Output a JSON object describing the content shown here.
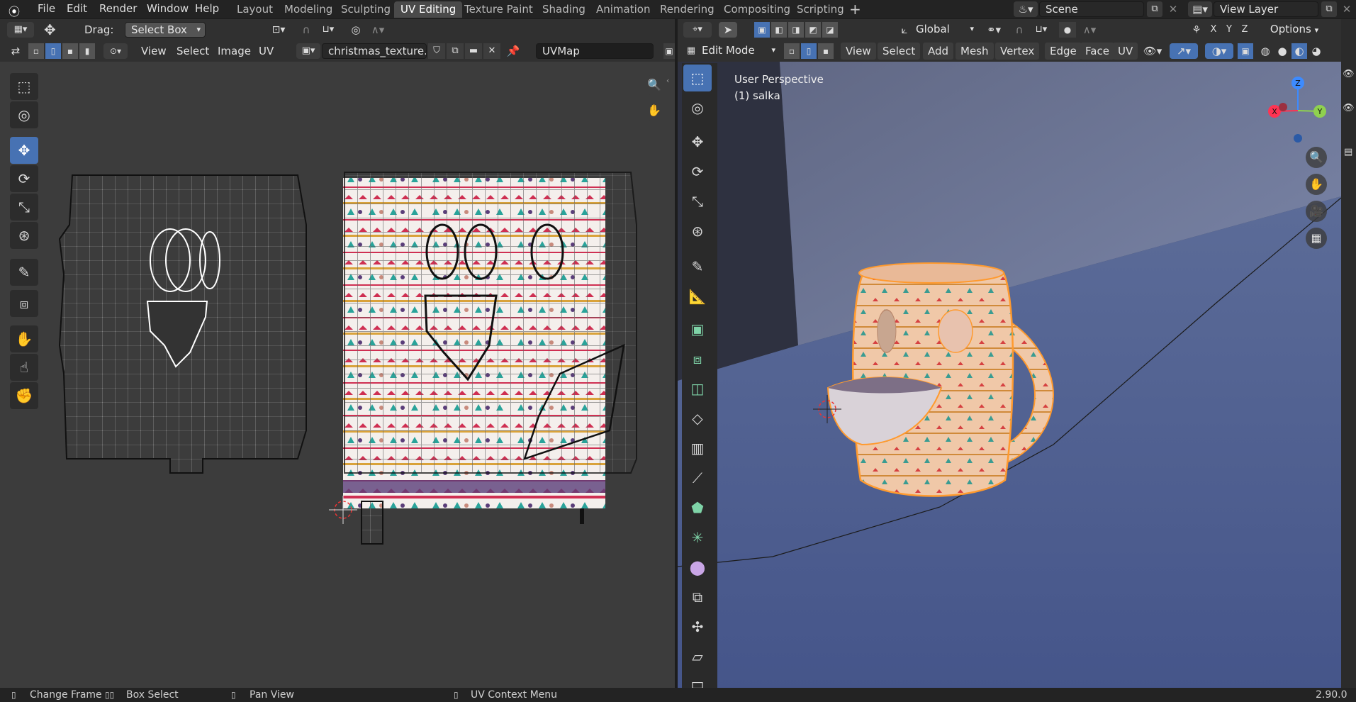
{
  "menus": [
    "File",
    "Edit",
    "Render",
    "Window",
    "Help"
  ],
  "workspace_tabs": [
    {
      "label": "Layout",
      "active": false
    },
    {
      "label": "Modeling",
      "active": false
    },
    {
      "label": "Sculpting",
      "active": false
    },
    {
      "label": "UV Editing",
      "active": true
    },
    {
      "label": "Texture Paint",
      "active": false
    },
    {
      "label": "Shading",
      "active": false
    },
    {
      "label": "Animation",
      "active": false
    },
    {
      "label": "Rendering",
      "active": false
    },
    {
      "label": "Compositing",
      "active": false
    },
    {
      "label": "Scripting",
      "active": false
    }
  ],
  "scene": {
    "value": "Scene"
  },
  "view_layer": {
    "value": "View Layer"
  },
  "uv_editor": {
    "drag_label": "Drag:",
    "drag_value": "Select Box",
    "menu": [
      "View",
      "Select",
      "Image",
      "UV"
    ],
    "image_name": "christmas_texture.j...",
    "uvmap": "UVMap"
  },
  "viewport": {
    "transform": "Global",
    "options": "Options",
    "mode": "Edit Mode",
    "menu": [
      "View",
      "Select",
      "Add",
      "Mesh",
      "Vertex",
      "Edge",
      "Face",
      "UV"
    ],
    "overlay_title": "User Perspective",
    "overlay_object": "(1) salka",
    "axis_labels": {
      "x": "X",
      "y": "Y",
      "z": "Z"
    }
  },
  "status": {
    "items": [
      "Change Frame",
      "Box Select",
      "Pan View",
      "UV Context Menu"
    ],
    "version": "2.90.0"
  },
  "colors": {
    "accent": "#4772b3",
    "mesh_edge": "#ff9a2e"
  }
}
